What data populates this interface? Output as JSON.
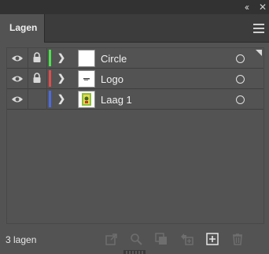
{
  "panel": {
    "tab_label": "Lagen",
    "layer_count": "3 lagen"
  },
  "layers": [
    {
      "name": "Circle",
      "color": "#4be34b",
      "locked": true,
      "thumb": "white"
    },
    {
      "name": "Logo",
      "color": "#e34b4b",
      "locked": true,
      "thumb": "logo"
    },
    {
      "name": "Laag 1",
      "color": "#4b6be3",
      "locked": false,
      "thumb": "image"
    }
  ],
  "footer_icons": [
    "export-icon",
    "search-icon",
    "clipping-mask-icon",
    "new-sublayer-icon",
    "new-layer-icon",
    "trash-icon"
  ],
  "colors": {
    "panel_bg": "#535353",
    "header_bg": "#323232",
    "tab_bar_bg": "#3c3c3c"
  }
}
